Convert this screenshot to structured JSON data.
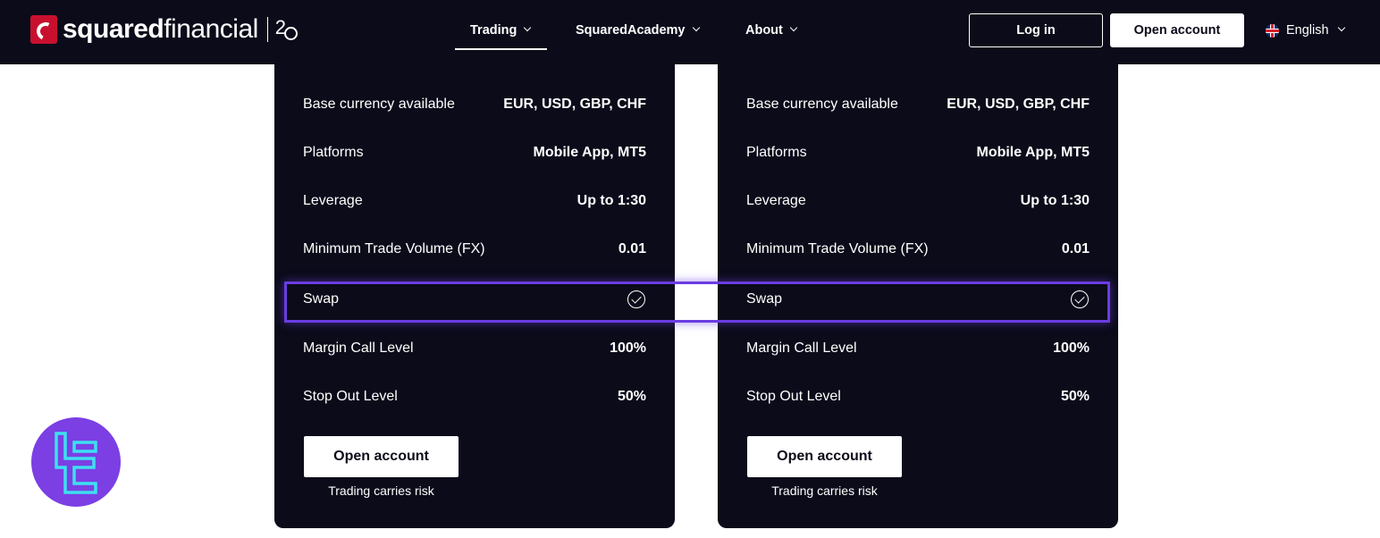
{
  "header": {
    "brand": {
      "regular": "squared",
      "bold": "financial",
      "anniversary": "2"
    },
    "nav": [
      {
        "label": "Trading",
        "active": true
      },
      {
        "label": "SquaredAcademy",
        "active": false
      },
      {
        "label": "About",
        "active": false
      }
    ],
    "login_label": "Log in",
    "open_account_label": "Open account",
    "language": "English"
  },
  "cards": [
    {
      "rows": [
        {
          "label": "Base currency available",
          "value": "EUR, USD, GBP, CHF"
        },
        {
          "label": "Platforms",
          "value": "Mobile App, MT5"
        },
        {
          "label": "Leverage",
          "value": "Up to 1:30"
        },
        {
          "label": "Minimum Trade Volume (FX)",
          "value": "0.01"
        },
        {
          "label": "Swap",
          "value": "",
          "icon": "check-circle-icon"
        },
        {
          "label": "Margin Call Level",
          "value": "100%"
        },
        {
          "label": "Stop Out Level",
          "value": "50%"
        }
      ],
      "button_label": "Open account",
      "risk_note": "Trading carries risk"
    },
    {
      "rows": [
        {
          "label": "Base currency available",
          "value": "EUR, USD, GBP, CHF"
        },
        {
          "label": "Platforms",
          "value": "Mobile App, MT5"
        },
        {
          "label": "Leverage",
          "value": "Up to 1:30"
        },
        {
          "label": "Minimum Trade Volume (FX)",
          "value": "0.01"
        },
        {
          "label": "Swap",
          "value": "",
          "icon": "check-circle-icon"
        },
        {
          "label": "Margin Call Level",
          "value": "100%"
        },
        {
          "label": "Stop Out Level",
          "value": "50%"
        }
      ],
      "button_label": "Open account",
      "risk_note": "Trading carries risk"
    }
  ],
  "colors": {
    "navbar_bg": "#0b0b1a",
    "card_bg": "#0b0b1a",
    "highlight": "#6a3de0",
    "badge": "#7b3fe4",
    "badge_glyph": "#3de0f0"
  }
}
